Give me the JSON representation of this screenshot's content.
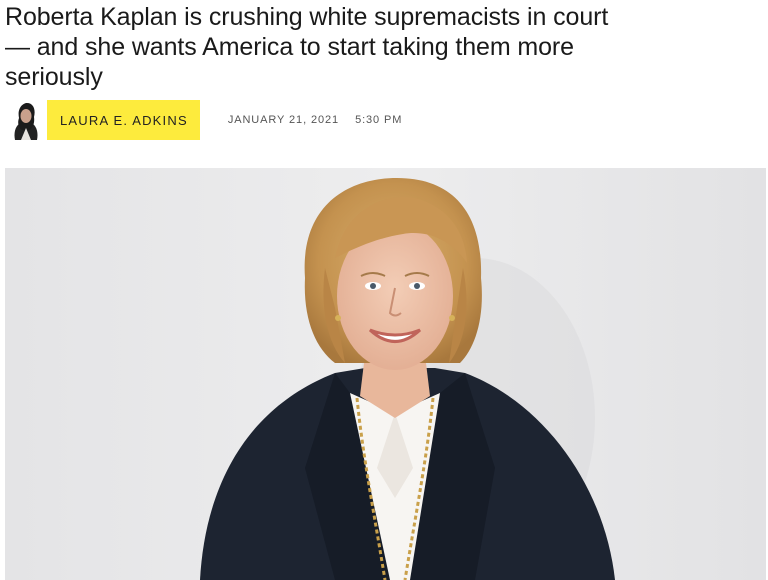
{
  "article": {
    "headline": "Roberta Kaplan is crushing white supremacists in court — and she wants America to start taking them more seriously",
    "author": "LAURA E. ADKINS",
    "date": "JANUARY 21, 2021",
    "time": "5:30 PM"
  },
  "colors": {
    "author_chip": "#fdeb3d",
    "background": "#ffffff",
    "headline_text": "#1a1a1a"
  },
  "icons": {
    "avatar": "author-avatar",
    "hero": "hero-photo"
  }
}
